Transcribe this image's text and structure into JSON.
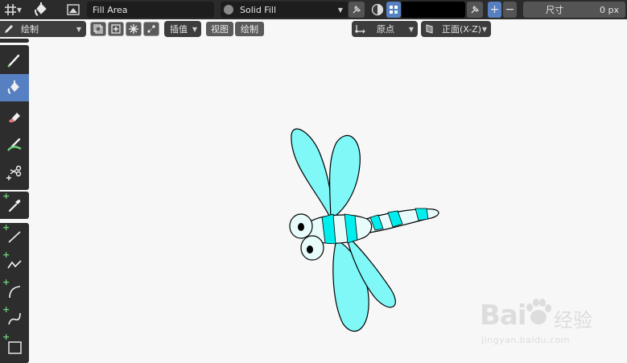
{
  "header": {
    "area_field": "Fill Area",
    "mode_field": "Solid Fill",
    "size_label": "尺寸",
    "size_value": "0 px",
    "plus": "+",
    "minus": "−",
    "color_hex": "#000000"
  },
  "toolbar": {
    "mode_dropdown": "绘制",
    "interpolate_dropdown": "插值",
    "view_menu": "视图",
    "draw_menu": "绘制",
    "origin_dropdown": "原点",
    "plane_dropdown": "正面(X-Z)"
  },
  "tools": [
    {
      "name": "draw-tool",
      "icon": "pencil-icon"
    },
    {
      "name": "fill-tool",
      "icon": "paint-bucket-icon",
      "active": true
    },
    {
      "name": "erase-tool",
      "icon": "eraser-icon"
    },
    {
      "name": "tint-tool",
      "icon": "tint-brush-icon"
    },
    {
      "name": "cutter-tool",
      "icon": "scissors-icon"
    },
    {
      "name": "eyedropper-tool",
      "icon": "eyedropper-icon"
    },
    {
      "name": "line-tool",
      "icon": "line-icon"
    },
    {
      "name": "polyline-tool",
      "icon": "polyline-icon"
    },
    {
      "name": "arc-tool",
      "icon": "arc-icon"
    },
    {
      "name": "curve-tool",
      "icon": "curve-icon"
    },
    {
      "name": "box-tool",
      "icon": "box-icon"
    }
  ],
  "colors": {
    "active_tool": "#5680c2",
    "wing_fill": "#80f8f8",
    "body_cyan": "#00eeee",
    "body_light": "#e8fbfb",
    "header_bg": "#2b2b2b"
  },
  "watermark": {
    "brand": "Bai",
    "brand_cn": "经验",
    "url": "jingyan.baidu.com"
  }
}
